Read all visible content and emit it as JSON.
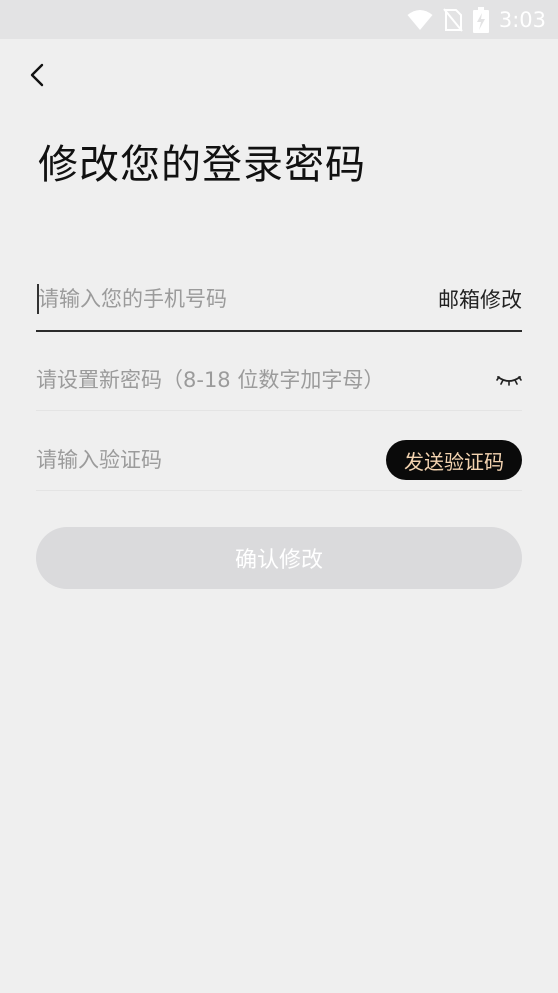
{
  "status_bar": {
    "time": "3:03",
    "icons": [
      "wifi-icon",
      "no-sim-icon",
      "battery-charging-icon"
    ]
  },
  "header": {
    "back_icon": "chevron-left-icon",
    "title": "修改您的登录密码"
  },
  "form": {
    "phone": {
      "placeholder": "请输入您的手机号码",
      "value": "",
      "switch_label": "邮箱修改"
    },
    "password": {
      "placeholder": "请设置新密码（8-18 位数字加字母）",
      "value": "",
      "toggle_icon": "eye-closed-icon"
    },
    "code": {
      "placeholder": "请输入验证码",
      "value": "",
      "send_label": "发送验证码"
    },
    "confirm_label": "确认修改"
  },
  "colors": {
    "background": "#efefef",
    "status_bar": "#e3e3e4",
    "send_button_bg": "#0a0a0a",
    "send_button_text": "#f3d3b0",
    "confirm_disabled": "#dadadc"
  }
}
